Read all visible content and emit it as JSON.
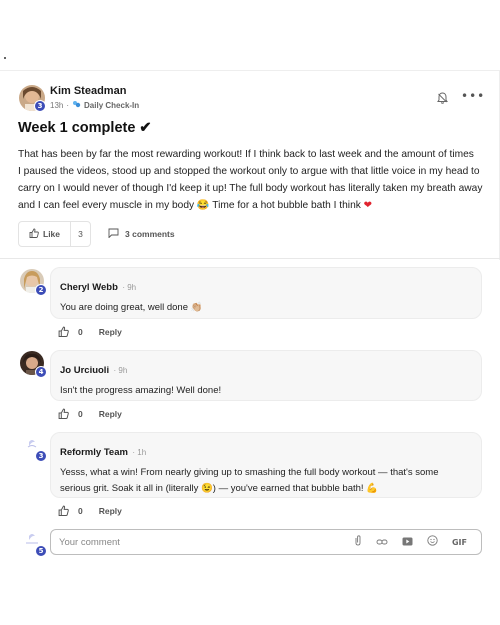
{
  "post": {
    "author": "Kim Steadman",
    "avatar_badge": "3",
    "time": "13h",
    "separator": "·",
    "category": "Daily Check-In",
    "title": "Week 1 complete ✔",
    "body_line1": "That has been by far the most rewarding workout! If I think back to last week and the amount of times",
    "body_line2": "I paused the videos, stood up and stopped the workout only to argue with that little voice in my head to",
    "body_line3": "carry on I would never of though I'd keep it up! The full body workout has literally taken my breath away",
    "body_line4a": "and I can feel every muscle in my body 😂 Time for a hot bubble bath I think ",
    "body_heart": "❤",
    "like_label": "Like",
    "like_count": "3",
    "comments_label": "3 comments"
  },
  "comments": [
    {
      "author": "Cheryl Webb",
      "time": "· 9h",
      "text": "You are doing great, well done 👏🏼",
      "badge": "2",
      "likes": "0",
      "reply": "Reply"
    },
    {
      "author": "Jo Urciuoli",
      "time": "· 9h",
      "text": "Isn't the progress amazing! Well done!",
      "badge": "4",
      "likes": "0",
      "reply": "Reply"
    },
    {
      "author": "Reformly Team",
      "time": "· 1h",
      "text_line1": "Yesss, what a win! From nearly giving up to smashing the full body workout — that's some",
      "text_line2": "serious grit. Soak it all in (literally 😉) — you've earned that bubble bath! 💪",
      "badge": "3",
      "likes": "0",
      "reply": "Reply"
    }
  ],
  "composer": {
    "placeholder": "Your comment",
    "badge": "5",
    "gif_label": "GIF"
  },
  "colors": {
    "badge": "#3d4db7",
    "heart": "#e0242f",
    "check_in": "#3b8fd9"
  },
  "icons": [
    "bell-icon",
    "more-icon",
    "thumbs-up-icon",
    "comment-icon",
    "attach-icon",
    "link-icon",
    "video-icon",
    "emoji-icon",
    "gif-icon"
  ]
}
